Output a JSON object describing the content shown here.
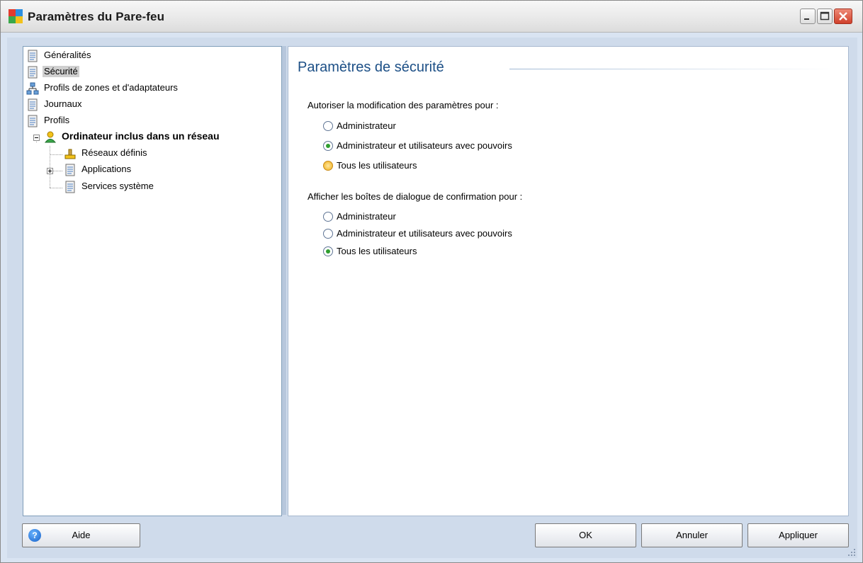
{
  "window": {
    "title": "Paramètres du Pare-feu"
  },
  "tree": {
    "items": [
      {
        "label": "Généralités"
      },
      {
        "label": "Sécurité"
      },
      {
        "label": "Profils de zones et d'adaptateurs"
      },
      {
        "label": "Journaux"
      },
      {
        "label": "Profils"
      },
      {
        "label": "Ordinateur inclus dans un réseau"
      },
      {
        "label": "Réseaux définis"
      },
      {
        "label": "Applications"
      },
      {
        "label": "Services système"
      }
    ],
    "selected": "Sécurité"
  },
  "main": {
    "title": "Paramètres de sécurité",
    "group1": {
      "label": "Autoriser la modification des paramètres pour :",
      "options": [
        "Administrateur",
        "Administrateur et utilisateurs avec pouvoirs",
        "Tous les utilisateurs"
      ],
      "selected": "Administrateur et utilisateurs avec pouvoirs"
    },
    "group2": {
      "label": "Afficher les boîtes de dialogue de confirmation pour :",
      "options": [
        "Administrateur",
        "Administrateur et utilisateurs avec pouvoirs",
        "Tous les utilisateurs"
      ],
      "selected": "Tous les utilisateurs"
    }
  },
  "buttons": {
    "help": "Aide",
    "ok": "OK",
    "cancel": "Annuler",
    "apply": "Appliquer"
  },
  "colors": {
    "title_blue": "#1c4f86",
    "radio_dot": "#2f9e2f",
    "close_red": "#d0402a"
  }
}
